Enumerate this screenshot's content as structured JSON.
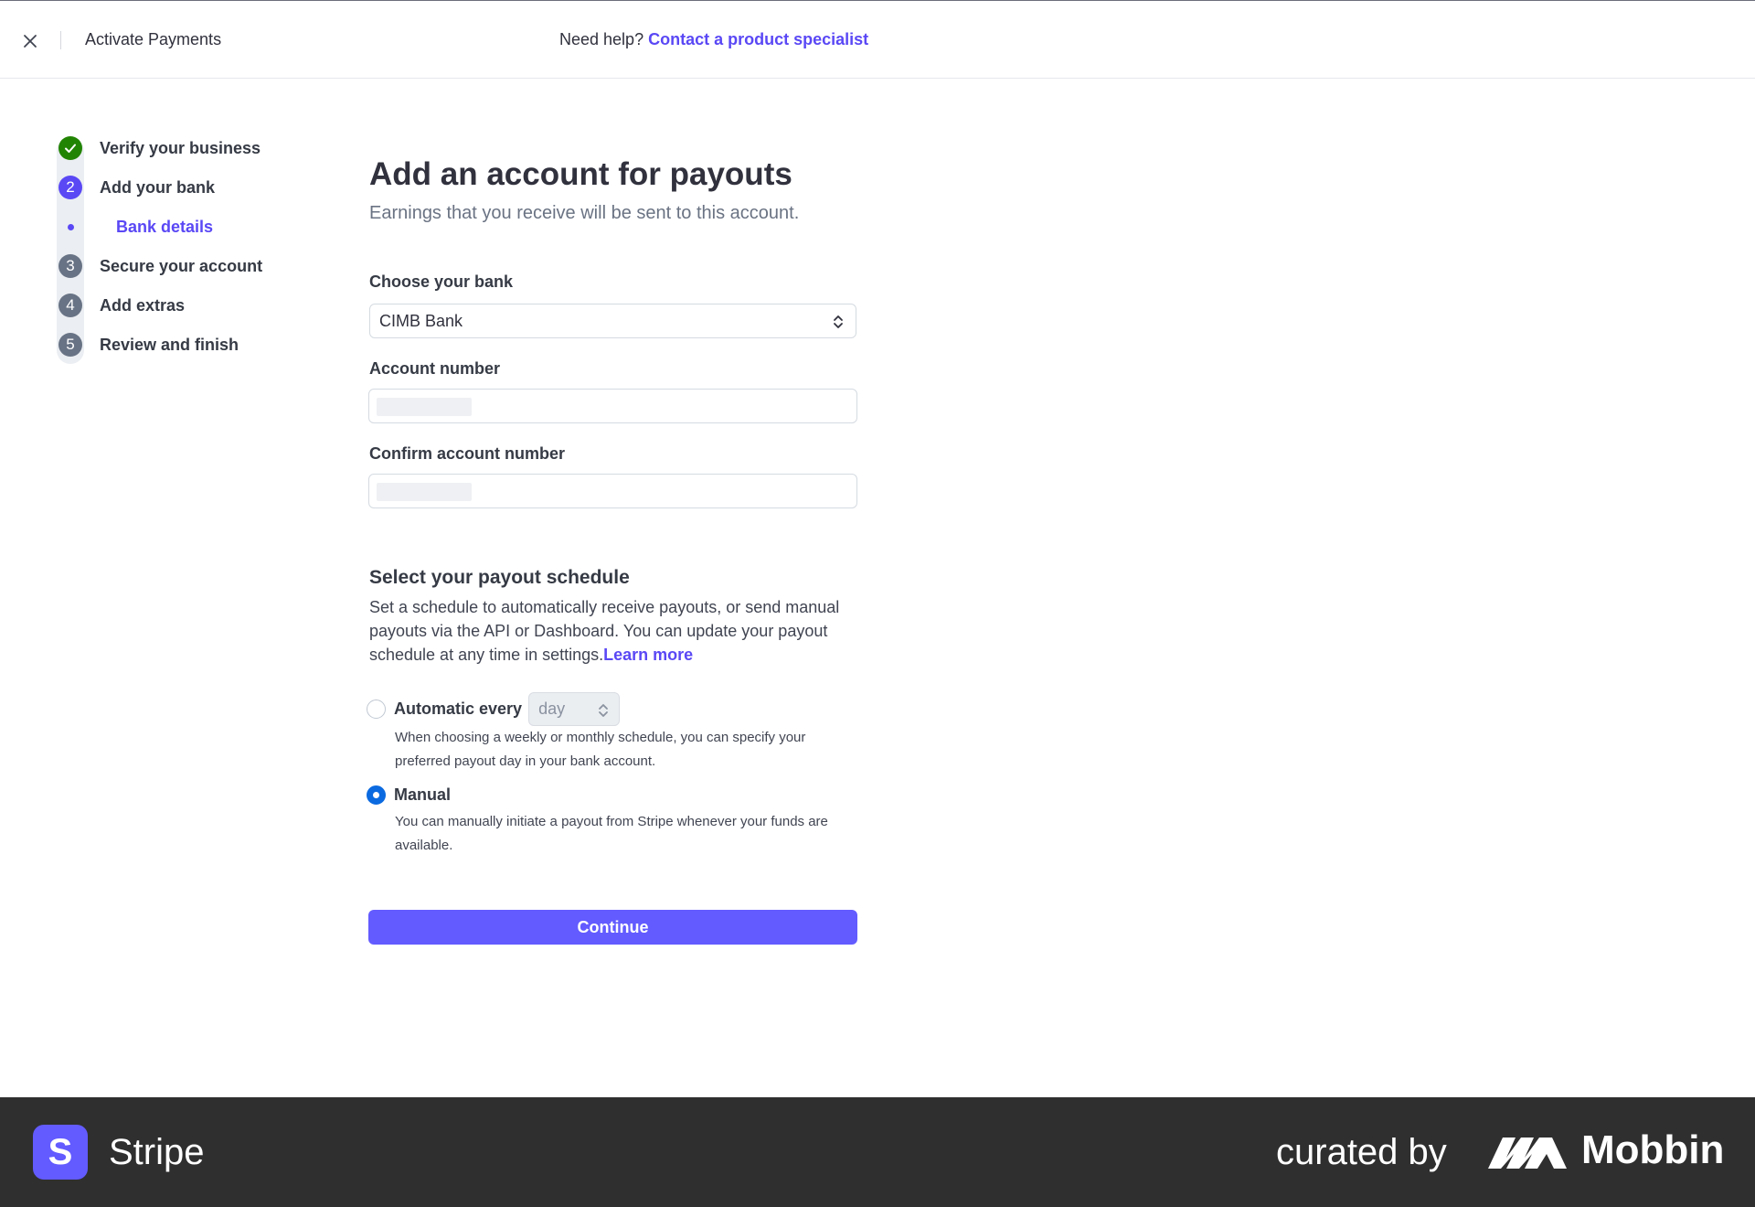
{
  "header": {
    "title": "Activate Payments",
    "help_prefix": "Need help?",
    "help_link": "Contact a product specialist"
  },
  "stepper": {
    "steps": [
      {
        "marker": "✓",
        "label": "Verify your business",
        "state": "done"
      },
      {
        "marker": "2",
        "label": "Add your bank",
        "state": "active"
      },
      {
        "marker": "",
        "label": "Bank details",
        "state": "current-substep"
      },
      {
        "marker": "3",
        "label": "Secure your account",
        "state": "todo"
      },
      {
        "marker": "4",
        "label": "Add extras",
        "state": "todo"
      },
      {
        "marker": "5",
        "label": "Review and finish",
        "state": "todo"
      }
    ]
  },
  "form": {
    "title": "Add an account for payouts",
    "subtitle": "Earnings that you receive will be sent to this account.",
    "bank_label": "Choose your bank",
    "bank_value": "CIMB Bank",
    "account_label": "Account number",
    "confirm_label": "Confirm account number",
    "schedule_title": "Select your payout schedule",
    "schedule_desc": "Set a schedule to automatically receive payouts, or send manual payouts via the API or Dashboard. You can update your payout schedule at any time in settings.",
    "learn_more": "Learn more",
    "auto_label": "Automatic every",
    "auto_interval": "day",
    "auto_help": "When choosing a weekly or monthly schedule, you can specify your preferred payout day in your bank account.",
    "manual_label": "Manual",
    "manual_help": "You can manually initiate a payout from Stripe whenever your funds are available.",
    "selected_schedule": "Manual",
    "continue": "Continue"
  },
  "footer": {
    "brand_initial": "S",
    "brand": "Stripe",
    "curated": "curated by",
    "curator": "Mobbin"
  },
  "colors": {
    "accent": "#635bff",
    "link": "#5a48f5",
    "success": "#228403",
    "radio_selected": "#0b6ae0",
    "footer_bg": "#2f2f2f"
  },
  "icons": {
    "close": "close-icon",
    "select_arrows": "chevron-updown-icon",
    "check": "check-icon"
  }
}
